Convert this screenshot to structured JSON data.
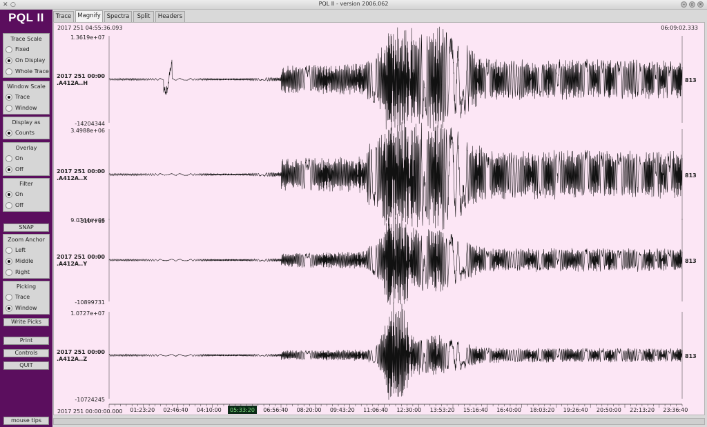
{
  "window": {
    "title": "PQL II - version 2006.062",
    "close_glyph": "✕",
    "app_glyph": "○"
  },
  "sidebar": {
    "logo": "PQL II",
    "trace_scale": {
      "title": "Trace Scale",
      "options": [
        "Fixed",
        "On Display",
        "Whole Trace"
      ],
      "selected": 1
    },
    "window_scale": {
      "title": "Window Scale",
      "options": [
        "Trace",
        "Window"
      ],
      "selected": 0
    },
    "display_as": {
      "title": "Display as",
      "options": [
        "Counts"
      ],
      "selected": 0
    },
    "overlay": {
      "title": "Overlay",
      "options": [
        "On",
        "Off"
      ],
      "selected": 1
    },
    "filter": {
      "title": "Filter",
      "options": [
        "On",
        "Off"
      ],
      "selected": 0
    },
    "snap_label": "SNAP",
    "zoom_anchor": {
      "title": "Zoom Anchor",
      "options": [
        "Left",
        "Middle",
        "Right"
      ],
      "selected": 1
    },
    "picking": {
      "title": "Picking",
      "options": [
        "Trace",
        "Window"
      ],
      "selected": 1
    },
    "write_picks_label": "Write Picks",
    "print_label": "Print",
    "controls_label": "Controls",
    "quit_label": "QUIT",
    "mouse_tips_label": "mouse tips"
  },
  "tabs": [
    "Trace",
    "Magnify",
    "Spectra",
    "Split",
    "Headers"
  ],
  "active_tab": 1,
  "plot": {
    "start_time": "2017 251 04:55:36.093",
    "end_time": "06:09:02.333",
    "axis_origin_label": "2017 251 00:00:00.000",
    "time_ticks": [
      "01:23:20",
      "02:46:40",
      "04:10:00",
      "05:33:20",
      "06:56:40",
      "08:20:00",
      "09:43:20",
      "11:06:40",
      "12:30:00",
      "13:53:20",
      "15:16:40",
      "16:40:00",
      "18:03:20",
      "19:26:40",
      "20:50:00",
      "22:13:20",
      "23:36:40"
    ],
    "highlighted_tick": 3,
    "traces": [
      {
        "date": "2017 251 00:00",
        "channel": ".A412A..H",
        "max": "1.3619e+07",
        "min": "-14204344",
        "samples": "813"
      },
      {
        "date": "2017 251 00:00",
        "channel": ".A412A..X",
        "max": "3.4988e+06",
        "min": "-3107765",
        "samples": "813"
      },
      {
        "date": "2017 251 00:00",
        "channel": ".A412A..Y",
        "max": "9.0744e+06",
        "min": "-10899731",
        "samples": "813"
      },
      {
        "date": "2017 251 00:00",
        "channel": ".A412A..Z",
        "max": "1.0727e+07",
        "min": "-10724245",
        "samples": "813"
      }
    ]
  },
  "colors": {
    "sidebar_bg": "#5b0e5e",
    "plot_bg": "#fce6f5",
    "trace_color": "#111111",
    "highlight_tick_bg": "#0b2a16",
    "highlight_tick_fg": "#7fdc7f"
  }
}
